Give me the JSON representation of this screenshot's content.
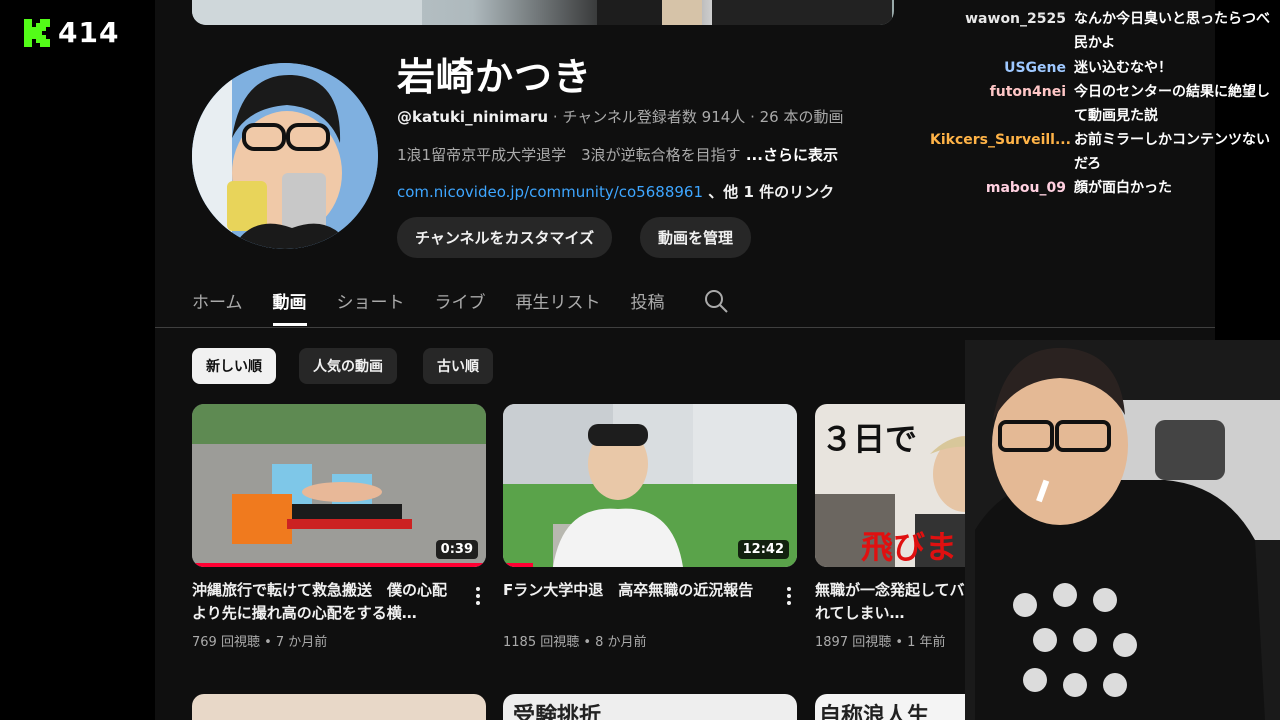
{
  "viewer_count": "414",
  "channel": {
    "name": "岩崎かつき",
    "handle": "@katuki_ninimaru",
    "meta": " · チャンネル登録者数 914人 · 26 本の動画",
    "description": "1浪1留帝京平成大学退学　3浪が逆転合格を目指す",
    "more": " ...さらに表示",
    "link": "com.nicovideo.jp/community/co5688961",
    "link_suffix": " 、他 1 件のリンク",
    "customize_label": "チャンネルをカスタマイズ",
    "manage_label": "動画を管理"
  },
  "tabs": [
    "ホーム",
    "動画",
    "ショート",
    "ライブ",
    "再生リスト",
    "投稿"
  ],
  "active_tab": "動画",
  "chips": [
    "新しい順",
    "人気の動画",
    "古い順"
  ],
  "videos": [
    {
      "title": "沖縄旅行で転けて救急搬送　僕の心配より先に撮れ高の心配をする横…",
      "duration": "0:39",
      "meta": "769 回視聴 • 7 か月前"
    },
    {
      "title": "Fラン大学中退　高卒無職の近況報告",
      "duration": "12:42",
      "meta": "1185 回視聴 • 8 か月前"
    },
    {
      "title": "無職が一念発起してバ…ど3日でバックれてしまい…",
      "thumb_text_1": "３日で",
      "thumb_text_2": "飛びま",
      "meta": "1897 回視聴 • 1 年前"
    }
  ],
  "row2_thumbs": [
    "受験挑折",
    "自称浪人生"
  ],
  "chat": [
    {
      "user": "wawon_2525",
      "color": "#e8e8e8",
      "text": "なんか今日臭いと思ったらつべ民かよ"
    },
    {
      "user": "USGene",
      "color": "#9ec8ff",
      "text": "迷い込むなや！"
    },
    {
      "user": "futon4nei",
      "color": "#ffc7c7",
      "text": "今日のセンターの結果に絶望して動画見た説"
    },
    {
      "user": "Kikcers_Surveill...",
      "color": "#ffb347",
      "text": "お前ミラーしかコンテンツないだろ"
    },
    {
      "user": "mabou_09",
      "color": "#ffd0e0",
      "text": "顔が面白かった"
    }
  ]
}
